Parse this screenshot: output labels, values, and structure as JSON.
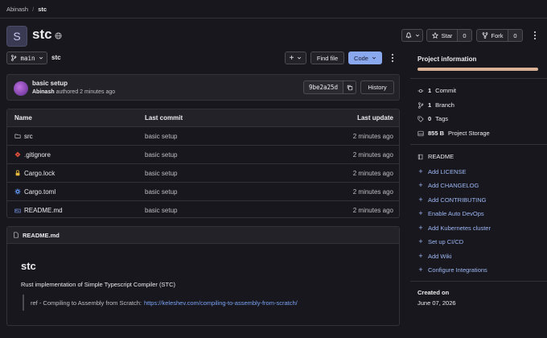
{
  "breadcrumb": {
    "parent": "Abinash",
    "separator": "/",
    "current": "stc"
  },
  "project": {
    "initial": "S",
    "name": "stc"
  },
  "header_actions": {
    "star_label": "Star",
    "star_count": "0",
    "fork_label": "Fork",
    "fork_count": "0"
  },
  "toolbar": {
    "branch": "main",
    "path": "stc",
    "add_label": "+",
    "find_file_label": "Find file",
    "code_label": "Code"
  },
  "commit": {
    "title": "basic setup",
    "author": "Abinash",
    "meta": "authored 2 minutes ago",
    "sha": "9be2a25d",
    "history_label": "History"
  },
  "files": {
    "headers": [
      "Name",
      "Last commit",
      "Last update"
    ],
    "rows": [
      {
        "name": "src",
        "icon": "folder-icon",
        "commit": "basic setup",
        "updated": "2 minutes ago"
      },
      {
        "name": ".gitignore",
        "icon": "git-icon",
        "commit": "basic setup",
        "updated": "2 minutes ago"
      },
      {
        "name": "Cargo.lock",
        "icon": "lock-icon",
        "commit": "basic setup",
        "updated": "2 minutes ago"
      },
      {
        "name": "Cargo.toml",
        "icon": "gear-icon",
        "commit": "basic setup",
        "updated": "2 minutes ago"
      },
      {
        "name": "README.md",
        "icon": "markdown-icon",
        "commit": "basic setup",
        "updated": "2 minutes ago"
      }
    ]
  },
  "readme": {
    "file": "README.md",
    "heading": "stc",
    "description": "Rust implementation of Simple Typescript Compiler (STC)",
    "quote_prefix": "ref - Compiling to Assembly from Scratch:",
    "quote_link": "https://keleshev.com/compiling-to-assembly-from-scratch/"
  },
  "sidebar": {
    "title": "Project information",
    "stats": [
      {
        "icon": "commit-icon",
        "value": "1",
        "label": "Commit"
      },
      {
        "icon": "branch-icon",
        "value": "1",
        "label": "Branch"
      },
      {
        "icon": "tag-icon",
        "value": "0",
        "label": "Tags"
      },
      {
        "icon": "storage-icon",
        "value": "855 B",
        "label": "Project Storage"
      }
    ],
    "readme_label": "README",
    "links": [
      "Add LICENSE",
      "Add CHANGELOG",
      "Add CONTRIBUTING",
      "Enable Auto DevOps",
      "Add Kubernetes cluster",
      "Set up CI/CD",
      "Add Wiki",
      "Configure Integrations"
    ],
    "created_label": "Created on",
    "created_date": "June 07, 2026"
  },
  "colors": {
    "background": "#18171d",
    "accent": "#8aa8ee",
    "link": "#9db8f5",
    "progress": "#d9b295"
  }
}
